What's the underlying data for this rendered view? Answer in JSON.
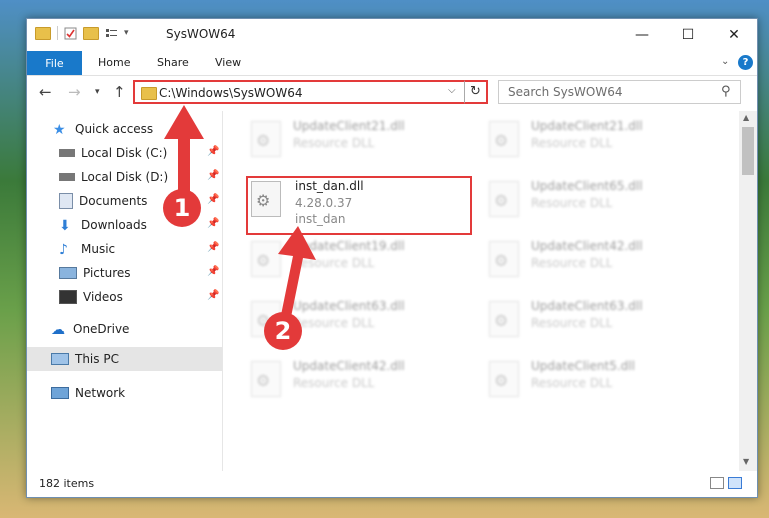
{
  "window": {
    "title": "SysWOW64",
    "controls": {
      "minimize": "—",
      "maximize": "☐",
      "close": "✕"
    }
  },
  "ribbon": {
    "file": "File",
    "tabs": [
      "Home",
      "Share",
      "View"
    ],
    "help": "?"
  },
  "address": {
    "path": "C:\\Windows\\SysWOW64",
    "search_placeholder": "Search SysWOW64"
  },
  "sidebar": {
    "items": [
      {
        "label": "Quick access"
      },
      {
        "label": "Local Disk (C:)"
      },
      {
        "label": "Local Disk (D:)"
      },
      {
        "label": "Documents"
      },
      {
        "label": "Downloads"
      },
      {
        "label": "Music"
      },
      {
        "label": "Pictures"
      },
      {
        "label": "Videos"
      },
      {
        "label": "OneDrive"
      },
      {
        "label": "This PC"
      },
      {
        "label": "Network"
      }
    ]
  },
  "files": [
    {
      "name": "UpdateClient21.dll",
      "sub": "Resource DLL"
    },
    {
      "name": "UpdateClient21.dll",
      "sub": "Resource DLL"
    },
    {
      "name": "inst_dan.dll",
      "sub": "4.28.0.37",
      "sub2": "inst_dan"
    },
    {
      "name": "UpdateClient65.dll",
      "sub": "Resource DLL"
    },
    {
      "name": "UpdateClient19.dll",
      "sub": "Resource DLL"
    },
    {
      "name": "UpdateClient42.dll",
      "sub": "Resource DLL"
    },
    {
      "name": "UpdateClient63.dll",
      "sub": "Resource DLL"
    },
    {
      "name": "UpdateClient63.dll",
      "sub": "Resource DLL"
    },
    {
      "name": "UpdateClient42.dll",
      "sub": "Resource DLL"
    },
    {
      "name": "UpdateClient5.dll",
      "sub": "Resource DLL"
    }
  ],
  "status": {
    "count": "182 items"
  },
  "annotations": {
    "step1": "1",
    "step2": "2"
  },
  "colors": {
    "accent": "#1979ca",
    "highlight": "#e33a3a"
  }
}
